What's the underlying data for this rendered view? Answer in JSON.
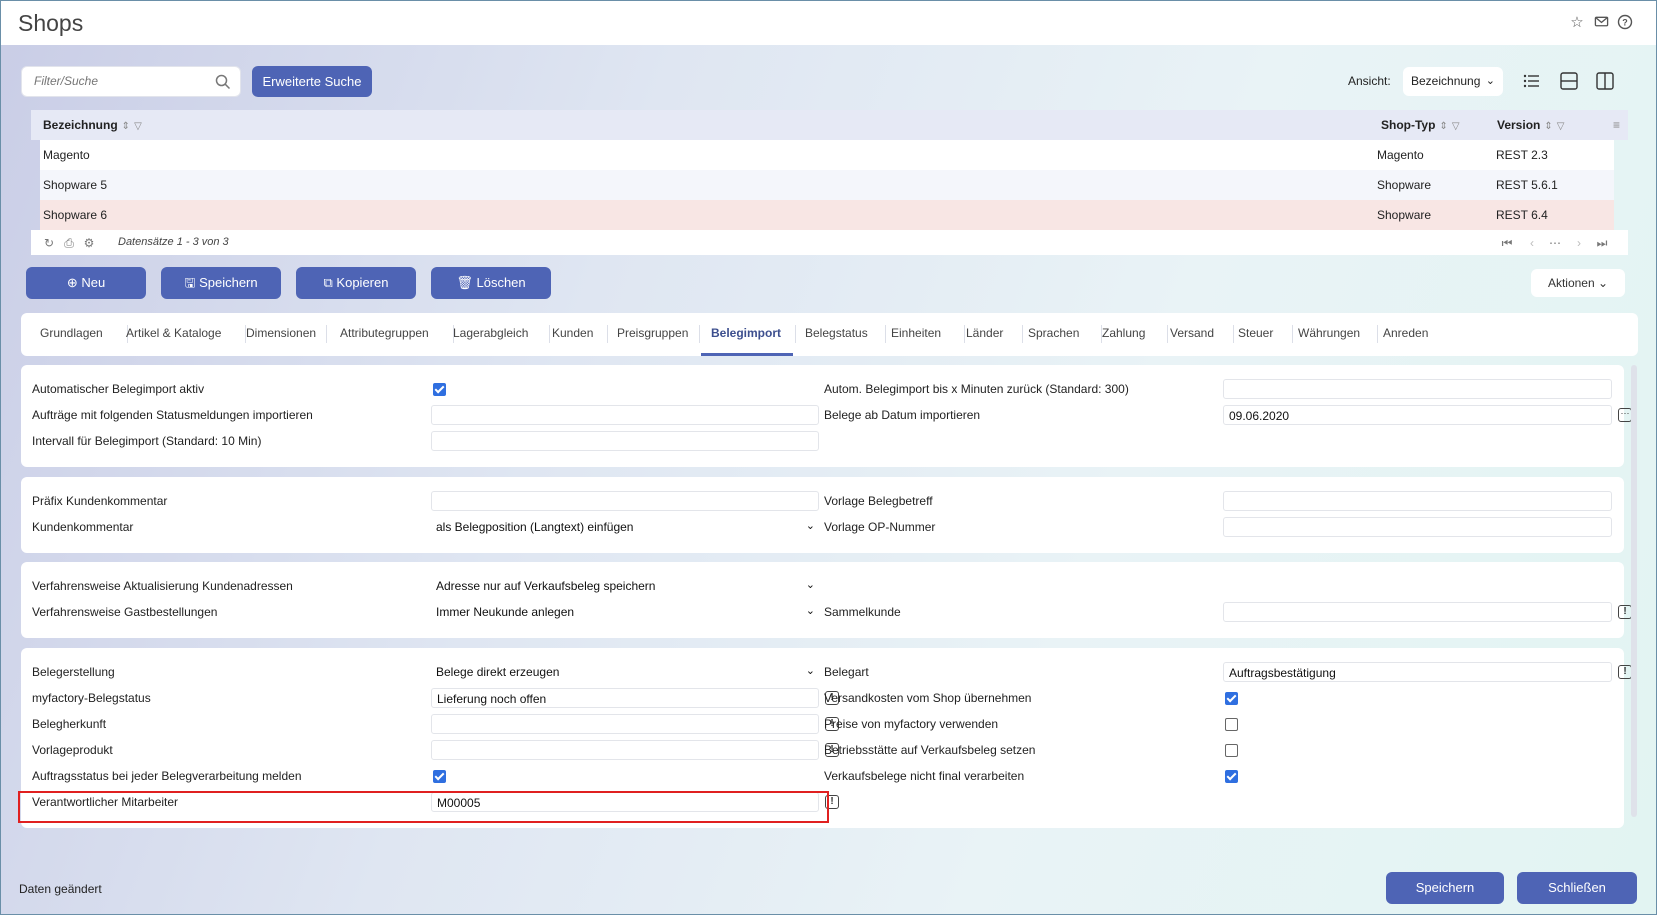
{
  "window": {
    "title": "Shops"
  },
  "search": {
    "placeholder": "Filter/Suche",
    "advanced_label": "Erweiterte Suche"
  },
  "view": {
    "label": "Ansicht:",
    "selected": "Bezeichnung"
  },
  "grid": {
    "columns": [
      "Bezeichnung",
      "Shop-Typ",
      "Version"
    ],
    "rows": [
      {
        "name": "Magento",
        "type": "Magento",
        "version": "REST 2.3"
      },
      {
        "name": "Shopware 5",
        "type": "Shopware",
        "version": "REST 5.6.1"
      },
      {
        "name": "Shopware 6",
        "type": "Shopware",
        "version": "REST 6.4"
      }
    ],
    "records_info": "Datensätze 1 - 3 von 3"
  },
  "toolbar": {
    "new": "Neu",
    "save": "Speichern",
    "copy": "Kopieren",
    "delete": "Löschen",
    "actions": "Aktionen"
  },
  "tabs": [
    "Grundlagen",
    "Artikel & Kataloge",
    "Dimensionen",
    "Attributegruppen",
    "Lagerabgleich",
    "Kunden",
    "Preisgruppen",
    "Belegimport",
    "Belegstatus",
    "Einheiten",
    "Länder",
    "Sprachen",
    "Zahlung",
    "Versand",
    "Steuer",
    "Währungen",
    "Anreden"
  ],
  "active_tab": "Belegimport",
  "form": {
    "p1": {
      "auto_import_label": "Automatischer Belegimport aktiv",
      "status_msgs_label": "Aufträge mit folgenden Statusmeldungen importieren",
      "interval_label": "Intervall für Belegimport (Standard: 10 Min)",
      "minutes_back_label": "Autom. Belegimport bis x Minuten zurück (Standard: 300)",
      "from_date_label": "Belege ab Datum importieren",
      "from_date_value": "09.06.2020"
    },
    "p2": {
      "prefix_label": "Präfix Kundenkommentar",
      "comment_label": "Kundenkommentar",
      "comment_value": "als Belegposition (Langtext) einfügen",
      "subject_label": "Vorlage Belegbetreff",
      "op_label": "Vorlage OP-Nummer"
    },
    "p3": {
      "address_label": "Verfahrensweise Aktualisierung Kundenadressen",
      "address_value": "Adresse nur auf Verkaufsbeleg speichern",
      "guest_label": "Verfahrensweise Gastbestellungen",
      "guest_value": "Immer Neukunde anlegen",
      "collective_label": "Sammelkunde"
    },
    "p4": {
      "creation_label": "Belegerstellung",
      "creation_value": "Belege direkt erzeugen",
      "status_label": "myfactory-Belegstatus",
      "status_value": "Lieferung noch offen",
      "origin_label": "Belegherkunft",
      "template_label": "Vorlageprodukt",
      "report_label": "Auftragsstatus bei jeder Belegverarbeitung melden",
      "employee_label": "Verantwortlicher Mitarbeiter",
      "employee_value": "M00005",
      "doctype_label": "Belegart",
      "doctype_value": "Auftragsbestätigung",
      "shipping_label": "Versandkosten vom Shop übernehmen",
      "prices_label": "Preise von myfactory verwenden",
      "site_label": "Betriebsstätte auf Verkaufsbeleg setzen",
      "nonfinal_label": "Verkaufsbelege nicht final verarbeiten"
    }
  },
  "footer": {
    "status": "Daten geändert",
    "save": "Speichern",
    "close": "Schließen"
  },
  "colors": {
    "primary": "#4e64b5",
    "selected_row": "#f8e6e4",
    "highlight": "#e02020",
    "checkbox": "#2f6fe0"
  }
}
